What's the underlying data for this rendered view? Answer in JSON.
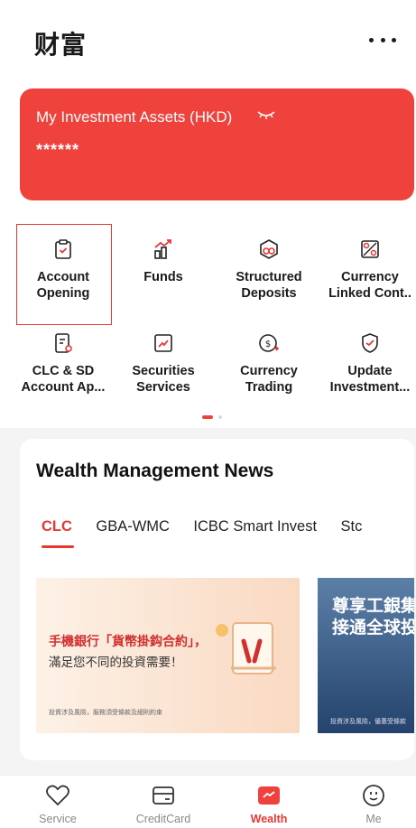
{
  "header": {
    "title": "财富"
  },
  "assets": {
    "title": "My Investment Assets (HKD)",
    "value": "******"
  },
  "grid": [
    {
      "label": "Account\nOpening",
      "icon": "clipboard-check-icon"
    },
    {
      "label": "Funds",
      "icon": "fund-chart-icon"
    },
    {
      "label": "Structured\nDeposits",
      "icon": "structured-deposit-icon"
    },
    {
      "label": "Currency\nLinked Cont..",
      "icon": "currency-linked-icon"
    },
    {
      "label": "CLC & SD\nAccount Ap...",
      "icon": "account-application-icon"
    },
    {
      "label": "Securities\nServices",
      "icon": "securities-chart-icon"
    },
    {
      "label": "Currency\nTrading",
      "icon": "currency-trading-icon"
    },
    {
      "label": "Update\nInvestment...",
      "icon": "update-investment-icon"
    }
  ],
  "news": {
    "title": "Wealth Management News",
    "tabs": [
      "CLC",
      "GBA-WMC",
      "ICBC Smart Invest",
      "Stc"
    ],
    "banner1": {
      "headline": "手機銀行「貨幣掛鈎合約」，",
      "subline": "滿足您不同的投資需要！",
      "footnote": "投資涉及風險，服務須受條款及細則約束"
    },
    "banner2": {
      "line1": "尊享工銀集",
      "line2": "接通全球投",
      "footnote": "投資涉及風險，優惠受條款"
    }
  },
  "tabbar": [
    {
      "label": "Service",
      "icon": "heart-icon"
    },
    {
      "label": "CreditCard",
      "icon": "credit-card-icon"
    },
    {
      "label": "Wealth",
      "icon": "wealth-icon"
    },
    {
      "label": "Me",
      "icon": "smiley-icon"
    }
  ],
  "colors": {
    "accent": "#f0423d",
    "active": "#e53935"
  }
}
